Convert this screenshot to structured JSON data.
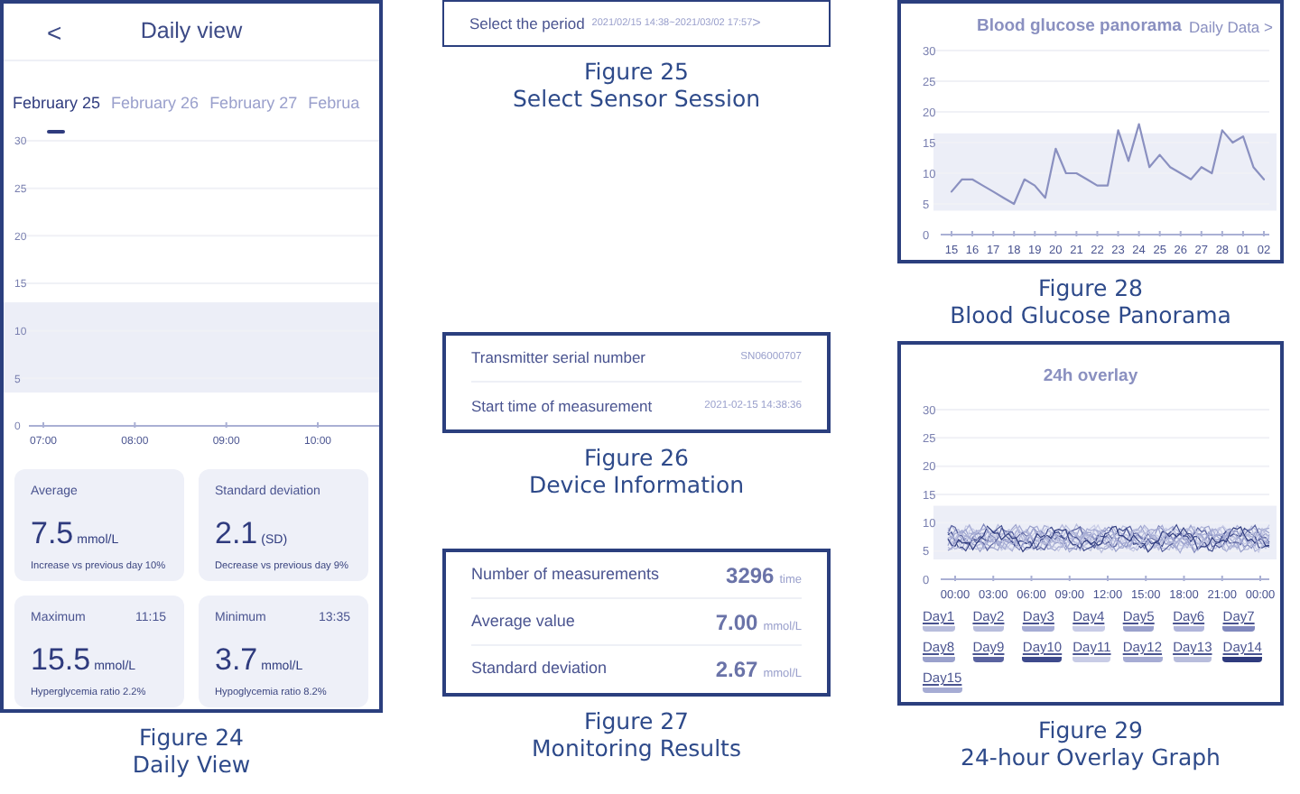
{
  "daily_view": {
    "back": "<",
    "title": "Daily view",
    "tabs": [
      {
        "label": "February 25",
        "selected": true
      },
      {
        "label": "February 26",
        "selected": false
      },
      {
        "label": "February 27",
        "selected": false
      },
      {
        "label": "Februa",
        "selected": false
      }
    ],
    "yticks": [
      "30",
      "25",
      "20",
      "15",
      "10",
      "5",
      "0"
    ],
    "xticks": [
      "07:00",
      "08:00",
      "09:00",
      "10:00"
    ],
    "cards": [
      {
        "label": "Average",
        "value": "7.5",
        "unit": "mmol/L",
        "note": "Increase vs previous day 10%"
      },
      {
        "label": "Standard deviation",
        "value": "2.1",
        "unit": "(SD)",
        "note": "Decrease vs previous day 9%"
      },
      {
        "label": "Maximum",
        "time": "11:15",
        "value": "15.5",
        "unit": "mmol/L",
        "note": "Hyperglycemia ratio 2.2%"
      },
      {
        "label": "Minimum",
        "time": "13:35",
        "value": "3.7",
        "unit": "mmol/L",
        "note": "Hypoglycemia ratio 8.2%"
      }
    ],
    "figure": "Figure 24",
    "caption": "Daily View"
  },
  "period": {
    "label": "Select the period",
    "range": "2021/02/15 14:38~2021/03/02 17:57",
    "chevron": ">",
    "figure": "Figure 25",
    "caption": "Select Sensor Session"
  },
  "device_info": {
    "rows": [
      {
        "label": "Transmitter serial number",
        "value": "SN06000707"
      },
      {
        "label": "Start time of measurement",
        "value": "2021-02-15 14:38:36"
      }
    ],
    "figure": "Figure 26",
    "caption": "Device Information"
  },
  "monitoring": {
    "rows": [
      {
        "label": "Number of measurements",
        "value": "3296",
        "unit": "time"
      },
      {
        "label": "Average value",
        "value": "7.00",
        "unit": "mmol/L"
      },
      {
        "label": "Standard deviation",
        "value": "2.67",
        "unit": "mmol/L"
      }
    ],
    "figure": "Figure 27",
    "caption": "Monitoring Results"
  },
  "panorama": {
    "link": "Daily Data",
    "chevron": ">",
    "chart_data": {
      "type": "line",
      "title": "Blood glucose panorama",
      "categories": [
        "15",
        null,
        "16",
        null,
        "17",
        null,
        "18",
        null,
        "19",
        null,
        "20",
        null,
        "21",
        null,
        "22",
        null,
        "23",
        null,
        "24",
        null,
        "25",
        null,
        "26",
        null,
        "27",
        null,
        "28",
        null,
        "01",
        null,
        "02"
      ],
      "values": [
        7,
        9,
        9,
        8,
        7,
        6,
        5,
        9,
        8,
        6,
        14,
        10,
        10,
        9,
        8,
        8,
        17,
        12,
        18,
        11,
        13,
        11,
        10,
        9,
        11,
        10,
        17,
        15,
        16,
        11,
        9
      ],
      "ylim": [
        0,
        30
      ],
      "yticks": [
        0,
        5,
        10,
        15,
        20,
        25,
        30
      ],
      "bands": [
        {
          "axis": "y",
          "from": 3.9,
          "to": 16.5
        }
      ]
    },
    "figure": "Figure 28",
    "caption": "Blood Glucose Panorama"
  },
  "overlay": {
    "title": "24h overlay",
    "yticks": [
      "30",
      "25",
      "20",
      "15",
      "10",
      "5",
      "0"
    ],
    "xticks": [
      "00:00",
      "03:00",
      "06:00",
      "09:00",
      "12:00",
      "15:00",
      "18:00",
      "21:00",
      "00:00"
    ],
    "days": [
      {
        "label": "Day1",
        "color": "#b8bddc"
      },
      {
        "label": "Day2",
        "color": "#b8bddc"
      },
      {
        "label": "Day3",
        "color": "#a6acd4"
      },
      {
        "label": "Day4",
        "color": "#c8cce6"
      },
      {
        "label": "Day5",
        "color": "#9aa1cc"
      },
      {
        "label": "Day6",
        "color": "#b0b5da"
      },
      {
        "label": "Day7",
        "color": "#8088bd"
      },
      {
        "label": "Day8",
        "color": "#9aa1cc"
      },
      {
        "label": "Day9",
        "color": "#5a63a0"
      },
      {
        "label": "Day10",
        "color": "#3e4a8c"
      },
      {
        "label": "Day11",
        "color": "#c8cce6"
      },
      {
        "label": "Day12",
        "color": "#a6acd4"
      },
      {
        "label": "Day13",
        "color": "#b8bddc"
      },
      {
        "label": "Day14",
        "color": "#2f3b7e"
      },
      {
        "label": "Day15",
        "color": "#a6acd4"
      }
    ],
    "figure": "Figure 29",
    "caption": "24-hour Overlay Graph"
  }
}
